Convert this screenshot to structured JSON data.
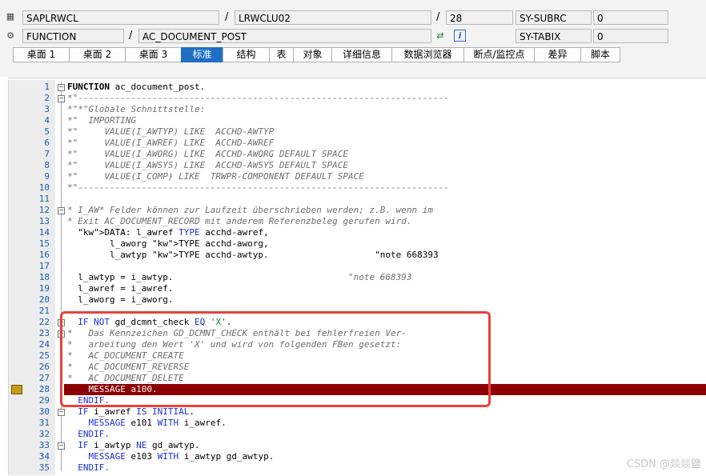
{
  "header": {
    "program": "SAPLRWCL",
    "include": "LRWCLU02",
    "line": "28",
    "subrc_label": "SY-SUBRC",
    "subrc_value": "0",
    "type": "FUNCTION",
    "name": "AC_DOCUMENT_POST",
    "tabix_label": "SY-TABIX",
    "tabix_value": "0"
  },
  "tabs": [
    {
      "label": "桌面 1",
      "w": 70
    },
    {
      "label": "桌面 2",
      "w": 70
    },
    {
      "label": "桌面 3",
      "w": 70
    },
    {
      "label": "标准",
      "w": 52,
      "active": true
    },
    {
      "label": "结构",
      "w": 58
    },
    {
      "label": "表",
      "w": 30
    },
    {
      "label": "对象",
      "w": 48
    },
    {
      "label": "详细信息",
      "w": 75
    },
    {
      "label": "数据浏览器",
      "w": 90
    },
    {
      "label": "断点/监控点",
      "w": 88
    },
    {
      "label": "差异",
      "w": 58
    },
    {
      "label": "脚本",
      "w": 50
    }
  ],
  "lines": [
    {
      "n": "1",
      "t": "FUNCTION ac_document_post.",
      "c": "fn"
    },
    {
      "n": "2",
      "t": "*\"----------------------------------------------------------------------",
      "c": "cmt"
    },
    {
      "n": "3",
      "t": "*\"*\"Globale Schnittstelle:",
      "c": "cmt"
    },
    {
      "n": "4",
      "t": "*\"  IMPORTING",
      "c": "cmt"
    },
    {
      "n": "5",
      "t": "*\"     VALUE(I_AWTYP) LIKE  ACCHD-AWTYP",
      "c": "cmt"
    },
    {
      "n": "6",
      "t": "*\"     VALUE(I_AWREF) LIKE  ACCHD-AWREF",
      "c": "cmt"
    },
    {
      "n": "7",
      "t": "*\"     VALUE(I_AWORG) LIKE  ACCHD-AWORG DEFAULT SPACE",
      "c": "cmt"
    },
    {
      "n": "8",
      "t": "*\"     VALUE(I_AWSYS) LIKE  ACCHD-AWSYS DEFAULT SPACE",
      "c": "cmt"
    },
    {
      "n": "9",
      "t": "*\"     VALUE(I_COMP) LIKE  TRWPR-COMPONENT DEFAULT SPACE",
      "c": "cmt"
    },
    {
      "n": "10",
      "t": "*\"----------------------------------------------------------------------",
      "c": "cmt"
    },
    {
      "n": "11",
      "t": "",
      "c": ""
    },
    {
      "n": "12",
      "t": "* I_AW* Felder können zur Laufzeit überschrieben werden; z.B. wenn im",
      "c": "cmt"
    },
    {
      "n": "13",
      "t": "* Exit AC_DOCUMENT_RECORD mit anderem Referenzbeleg gerufen wird.",
      "c": "cmt"
    },
    {
      "n": "14",
      "t": "  DATA: l_awref TYPE acchd-awref,",
      "c": "data"
    },
    {
      "n": "15",
      "t": "        l_aworg TYPE acchd-aworg,",
      "c": "data"
    },
    {
      "n": "16",
      "t": "        l_awtyp TYPE acchd-awtyp.                    \"note 668393",
      "c": "data"
    },
    {
      "n": "17",
      "t": "",
      "c": ""
    },
    {
      "n": "18",
      "t": "  l_awtyp = i_awtyp.                                 \"note 668393",
      "c": "data"
    },
    {
      "n": "19",
      "t": "  l_awref = i_awref.",
      "c": ""
    },
    {
      "n": "20",
      "t": "  l_aworg = i_aworg.",
      "c": ""
    },
    {
      "n": "21",
      "t": "",
      "c": ""
    },
    {
      "n": "22",
      "t": "  IF NOT gd_dcmnt_check EQ 'X'.",
      "c": "if"
    },
    {
      "n": "23",
      "t": "*   Das Kennzeichen GD_DCMNT_CHECK enthält bei fehlerfreien Ver-",
      "c": "cmt"
    },
    {
      "n": "24",
      "t": "*   arbeitung den Wert 'X' und wird von folgenden FBen gesetzt:",
      "c": "cmt"
    },
    {
      "n": "25",
      "t": "*   AC_DOCUMENT_CREATE",
      "c": "cmt"
    },
    {
      "n": "26",
      "t": "*   AC_DOCUMENT_REVERSE",
      "c": "cmt"
    },
    {
      "n": "27",
      "t": "*   AC_DOCUMENT_DELETE",
      "c": "cmt"
    },
    {
      "n": "28",
      "t": "    MESSAGE a100.",
      "c": "hl"
    },
    {
      "n": "29",
      "t": "  ENDIF.",
      "c": "kw"
    },
    {
      "n": "30",
      "t": "  IF i_awref IS INITIAL.",
      "c": "if2"
    },
    {
      "n": "31",
      "t": "    MESSAGE e101 WITH i_awref.",
      "c": "msg"
    },
    {
      "n": "32",
      "t": "  ENDIF.",
      "c": "kw"
    },
    {
      "n": "33",
      "t": "  IF i_awtyp NE gd_awtyp.",
      "c": "if3"
    },
    {
      "n": "34",
      "t": "    MESSAGE e103 WITH i_awtyp gd_awtyp.",
      "c": "msg2"
    },
    {
      "n": "35",
      "t": "  ENDIF.",
      "c": "kw"
    }
  ],
  "watermark": "CSDN @燚燚鹽"
}
